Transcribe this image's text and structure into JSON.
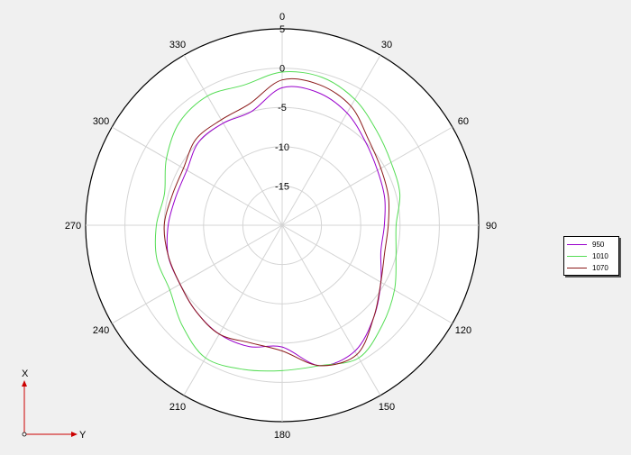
{
  "chart_data": {
    "type": "polar-line",
    "angle_ticks": [
      "0",
      "30",
      "60",
      "90",
      "120",
      "150",
      "180",
      "210",
      "240",
      "270",
      "300",
      "330"
    ],
    "radial_ticks": [
      "5",
      "0",
      "-5",
      "-10",
      "-15"
    ],
    "rlim": [
      -20,
      5
    ],
    "grid": true,
    "legend_position": "right",
    "axis_labels": {
      "x": "X",
      "y": "Y"
    },
    "series": [
      {
        "name": "950",
        "color": "#9900cc",
        "angles": [
          0,
          15,
          30,
          45,
          60,
          75,
          90,
          105,
          120,
          135,
          150,
          165,
          180,
          195,
          210,
          225,
          240,
          255,
          270,
          285,
          300,
          315,
          330,
          345
        ],
        "values": [
          -2.5,
          -2.5,
          -3.5,
          -5.0,
          -6.0,
          -6.5,
          -7.0,
          -7.0,
          -5.5,
          -3.5,
          -1.5,
          -1.5,
          -4.5,
          -4.0,
          -4.0,
          -4.5,
          -5.0,
          -5.0,
          -5.5,
          -6.0,
          -6.0,
          -5.0,
          -5.0,
          -5.0
        ]
      },
      {
        "name": "1010",
        "color": "#55dd55",
        "angles": [
          0,
          15,
          30,
          45,
          60,
          75,
          90,
          105,
          120,
          135,
          150,
          165,
          180,
          195,
          210,
          225,
          240,
          255,
          270,
          285,
          300,
          315,
          330,
          345
        ],
        "values": [
          -0.5,
          -0.5,
          -1.5,
          -3.0,
          -4.0,
          -4.5,
          -5.5,
          -5.0,
          -3.5,
          -2.0,
          -0.5,
          -1.5,
          -1.5,
          -1.0,
          -0.5,
          -2.0,
          -3.5,
          -3.5,
          -4.0,
          -4.5,
          -3.0,
          -1.5,
          -1.0,
          -1.5
        ]
      },
      {
        "name": "1070",
        "color": "#8b1a1a",
        "angles": [
          0,
          15,
          30,
          45,
          60,
          75,
          90,
          105,
          120,
          135,
          150,
          165,
          180,
          195,
          210,
          225,
          240,
          255,
          270,
          285,
          300,
          315,
          330,
          345
        ],
        "values": [
          -1.5,
          -1.5,
          -2.5,
          -4.5,
          -5.5,
          -6.0,
          -6.5,
          -6.5,
          -5.5,
          -3.5,
          -1.0,
          -1.5,
          -4.0,
          -4.5,
          -4.0,
          -4.5,
          -5.0,
          -5.0,
          -5.0,
          -5.5,
          -5.5,
          -4.5,
          -4.5,
          -4.0
        ]
      }
    ]
  }
}
